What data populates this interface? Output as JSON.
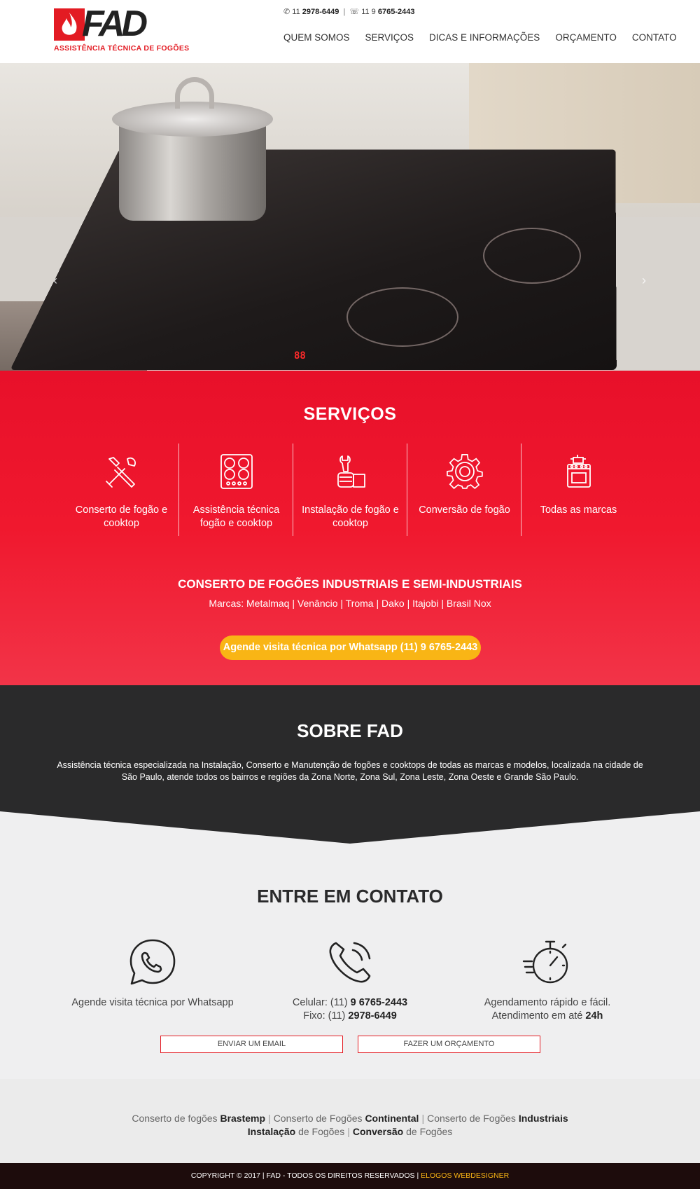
{
  "header": {
    "logo_letters": "FAD",
    "logo_tagline": "ASSISTÊNCIA TÉCNICA DE FOGÕES",
    "phone_fixed_prefix": "11",
    "phone_fixed": "2978-6449",
    "phone_mobile_prefix": "11 9",
    "phone_mobile": "6765-2443",
    "nav": [
      "QUEM SOMOS",
      "SERVIÇOS",
      "DICAS E INFORMAÇÕES",
      "ORÇAMENTO",
      "CONTATO"
    ]
  },
  "hero": {
    "display_digits": "88",
    "prev_arrow": "‹",
    "next_arrow": "›"
  },
  "services": {
    "title": "SERVIÇOS",
    "items": [
      {
        "label": "Conserto de fogão e cooktop",
        "icon": "tools-icon"
      },
      {
        "label": "Assistência técnica fogão e cooktop",
        "icon": "cooktop-icon"
      },
      {
        "label": "Instalação de fogão e cooktop",
        "icon": "installation-icon"
      },
      {
        "label": "Conversão de fogão",
        "icon": "gear-icon"
      },
      {
        "label": "Todas as marcas",
        "icon": "stove-icon"
      }
    ],
    "industrial_title": "CONSERTO DE FOGÕES INDUSTRIAIS E SEMI-INDUSTRIAIS",
    "brands": "Marcas: Metalmaq | Venâncio | Troma | Dako | Itajobi | Brasil Nox",
    "cta": "Agende visita técnica por Whatsapp (11) 9 6765-2443"
  },
  "about": {
    "title": "SOBRE FAD",
    "text": "Assistência técnica especializada na Instalação, Conserto e Manutenção de fogões e cooktops de todas as marcas e modelos, localizada na cidade de São Paulo, atende todos os bairros e regiões da Zona Norte, Zona Sul, Zona Leste, Zona Oeste e Grande São Paulo."
  },
  "contact": {
    "title": "ENTRE EM CONTATO",
    "whatsapp_text": "Agende visita técnica por Whatsapp",
    "mobile_label": "Celular: (11)",
    "mobile_number": "9 6765-2443",
    "fixed_label": "Fixo: (11)",
    "fixed_number": "2978-6449",
    "schedule_line1": "Agendamento rápido e fácil.",
    "schedule_line2_prefix": "Atendimento em até",
    "schedule_line2_value": "24h",
    "email_button": "ENVIAR UM EMAIL",
    "quote_button": "FAZER UM ORÇAMENTO"
  },
  "footer_links": {
    "line1": [
      {
        "pre": "Conserto de fogões",
        "bold": "Brastemp"
      },
      {
        "pre": "Conserto de Fogões",
        "bold": "Continental"
      },
      {
        "pre": "Conserto de Fogões",
        "bold": "Industriais"
      }
    ],
    "line2": [
      {
        "bold": "Instalação",
        "post": "de Fogões"
      },
      {
        "bold": "Conversão",
        "post": "de Fogões"
      }
    ]
  },
  "copyright": {
    "text": "COPYRIGHT © 2017 | FAD - TODOS OS DIREITOS RESERVADOS |",
    "developer": "ELOGOS WEBDESIGNER"
  },
  "colors": {
    "brand_red": "#e31b23",
    "cta_yellow": "#f9b515",
    "dark": "#2a2a2b"
  }
}
